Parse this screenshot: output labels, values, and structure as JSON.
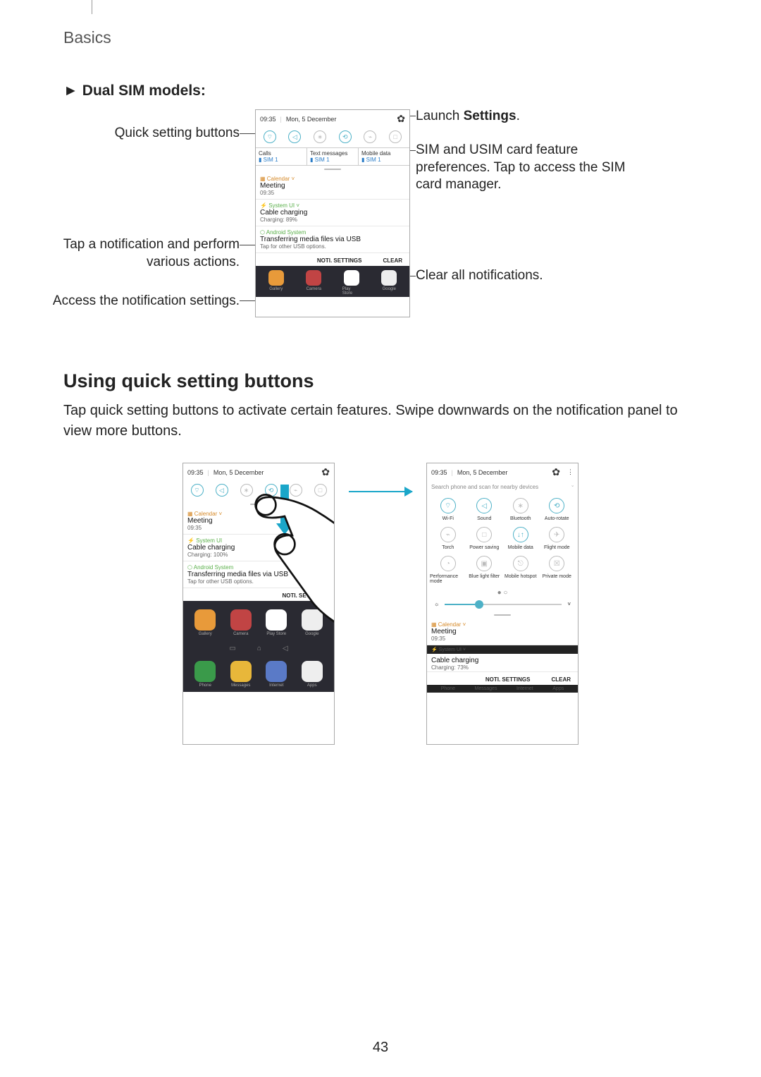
{
  "section": "Basics",
  "page_number": "43",
  "subheading_1_prefix": "►",
  "subheading_1": "Dual SIM models:",
  "callouts": {
    "quick_settings": "Quick setting buttons",
    "tap_notification": "Tap a notification and perform various actions.",
    "access_settings": "Access the notification settings.",
    "launch_settings_pre": "Launch ",
    "launch_settings_bold": "Settings",
    "launch_settings_post": ".",
    "sim_feature": "SIM and USIM card feature preferences. Tap to access the SIM card manager.",
    "clear_all": "Clear all notifications."
  },
  "heading_2": "Using quick setting buttons",
  "body_2": "Tap quick setting buttons to activate certain features. Swipe downwards on the notification panel to view more buttons.",
  "phone": {
    "time": "09:35",
    "date": "Mon, 5 December",
    "sim": {
      "calls": "Calls",
      "text": "Text messages",
      "data": "Mobile data",
      "sim1": "SIM 1"
    },
    "notifs": [
      {
        "app": "Calendar",
        "title": "Meeting",
        "sub": "09:35"
      },
      {
        "app": "System UI",
        "title": "Cable charging",
        "sub": "Charging: 89%"
      },
      {
        "app": "Android System",
        "title": "Transferring media files via USB",
        "sub": "Tap for other USB options."
      }
    ],
    "noti_settings": "NOTI. SETTINGS",
    "clear": "CLEAR",
    "apps_row1": [
      "Gallery",
      "Camera",
      "Play Store",
      "Google"
    ],
    "apps_row2": [
      "Phone",
      "Messages",
      "Internet",
      "Apps"
    ],
    "search_placeholder": "Search phone and scan for nearby devices",
    "charging_100": "Charging: 100%",
    "charging_73": "Charging: 73%",
    "qs_full": [
      "Wi-Fi",
      "Sound",
      "Bluetooth",
      "Auto-rotate",
      "Torch",
      "Power saving",
      "Mobile data",
      "Flight mode",
      "Performance mode",
      "Blue light filter",
      "Mobile hotspot",
      "Private mode"
    ]
  }
}
